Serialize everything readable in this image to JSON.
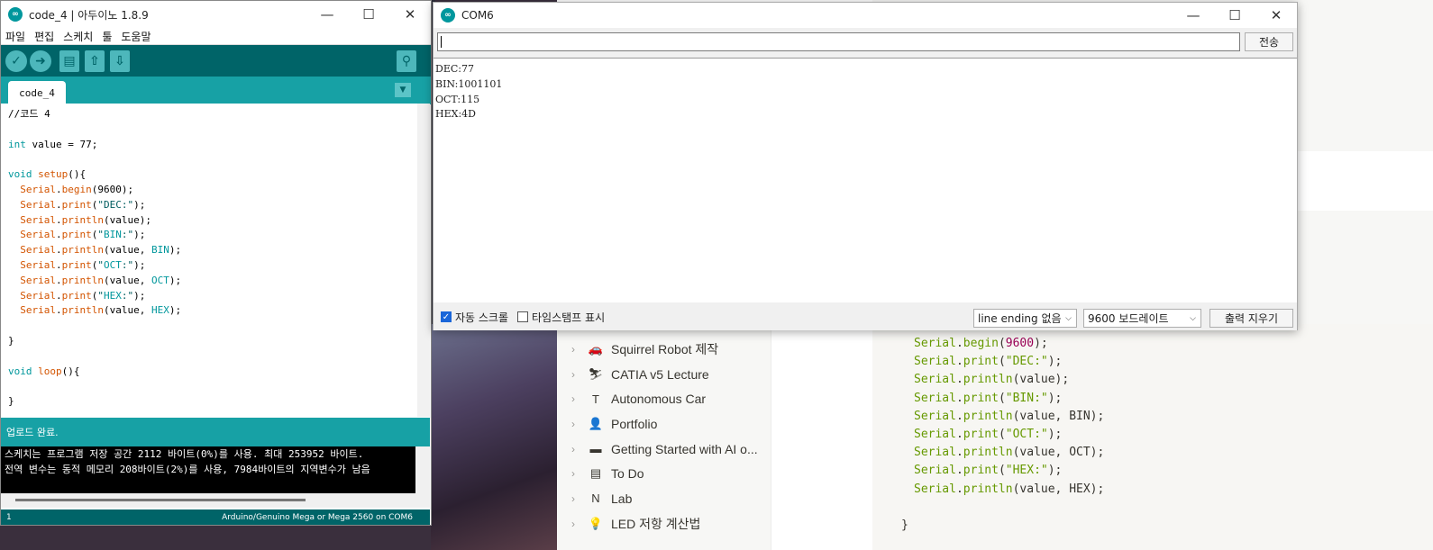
{
  "ide": {
    "window_title": "code_4 | 아두이노 1.8.9",
    "menu": [
      "파일",
      "편집",
      "스케치",
      "툴",
      "도움말"
    ],
    "tab_name": "code_4",
    "code_lines": [
      "//코드 4",
      "",
      "int value = 77;",
      "",
      "void setup(){",
      "  Serial.begin(9600);",
      "  Serial.print(\"DEC:\");",
      "  Serial.println(value);",
      "  Serial.print(\"BIN:\");",
      "  Serial.println(value, BIN);",
      "  Serial.print(\"OCT:\");",
      "  Serial.println(value, OCT);",
      "  Serial.print(\"HEX:\");",
      "  Serial.println(value, HEX);",
      "",
      "}",
      "",
      "void loop(){",
      "",
      "}"
    ],
    "status": "업로드 완료.",
    "console_lines": [
      "스케치는 프로그램 저장 공간 2112 바이트(0%)를 사용. 최대 253952 바이트.",
      "전역 변수는 동적 메모리 208바이트(2%)를 사용, 7984바이트의 지역변수가 남음"
    ],
    "line_number": "1",
    "board": "Arduino/Genuino Mega or Mega 2560 on COM6"
  },
  "serial": {
    "window_title": "COM6",
    "send_label": "전송",
    "input_value": "",
    "output_lines": [
      "DEC:77",
      "BIN:1001101",
      "OCT:115",
      "HEX:4D"
    ],
    "autoscroll_label": "자동 스크롤",
    "autoscroll_checked": true,
    "timestamp_label": "타임스탬프 표시",
    "timestamp_checked": false,
    "line_ending": "line ending 없음",
    "baud": "9600 보드레이트",
    "clear_label": "출력 지우기"
  },
  "notion": {
    "sidebar_items": [
      {
        "label": "Squirrel Robot 제작",
        "icon": "🚗"
      },
      {
        "label": "CATIA v5 Lecture",
        "icon": "⛷"
      },
      {
        "label": "Autonomous Car",
        "icon": "T"
      },
      {
        "label": "Portfolio",
        "icon": "👤"
      },
      {
        "label": "Getting Started with AI o...",
        "icon": "▬"
      },
      {
        "label": "To Do",
        "icon": "▤"
      },
      {
        "label": "Lab",
        "icon": "N"
      },
      {
        "label": "LED 저항 계산법",
        "icon": "💡"
      }
    ],
    "code_lines": [
      "Serial.begin(9600);",
      "Serial.print(\"DEC:\");",
      "Serial.println(value);",
      "Serial.print(\"BIN:\");",
      "Serial.println(value, BIN);",
      "Serial.print(\"OCT:\");",
      "Serial.println(value, OCT);",
      "Serial.print(\"HEX:\");",
      "Serial.println(value, HEX);",
      "",
      "}"
    ]
  },
  "colors": {
    "arduino_dark": "#006468",
    "arduino_teal": "#17a1a5",
    "keyword": "#00979c",
    "function": "#d35400"
  }
}
